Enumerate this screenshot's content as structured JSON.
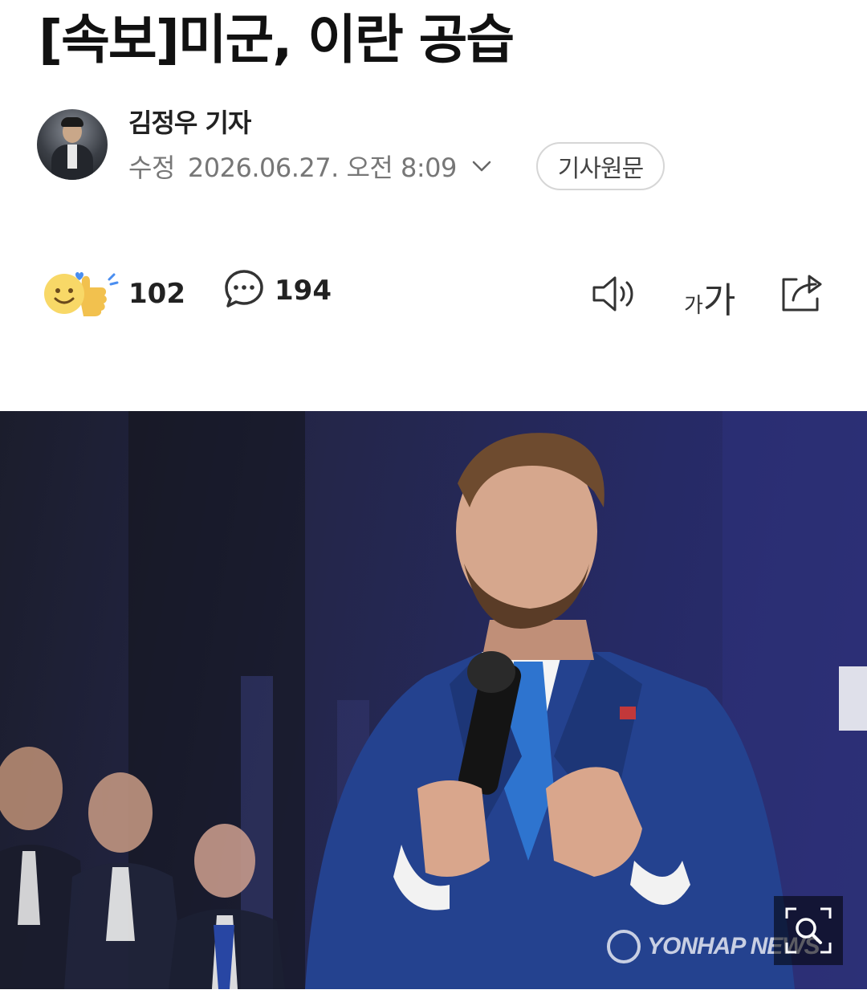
{
  "article": {
    "headline": "[속보]미군, 이란 공습",
    "reporter": "김정우 기자",
    "edited_label": "수정",
    "datetime": "2026.06.27. 오전 8:09",
    "original_button": "기사원문"
  },
  "stats": {
    "reactions": "102",
    "comments": "194"
  },
  "toolbar": {
    "font_small": "가",
    "font_large": "가"
  },
  "photo": {
    "watermark": "YONHAP NEWS"
  },
  "icons": {
    "reaction": "emoji-reaction-icon",
    "comment": "speech-bubble-icon",
    "tts": "speaker-icon",
    "font": "font-size-icon",
    "share": "share-icon",
    "expand": "chevron-down-icon",
    "zoom": "zoom-icon"
  },
  "colors": {
    "background": "#ffffff",
    "text_primary": "#111111",
    "text_meta": "#777777",
    "reaction_yellow": "#f7d35a",
    "reaction_blue": "#4a8ef0"
  }
}
